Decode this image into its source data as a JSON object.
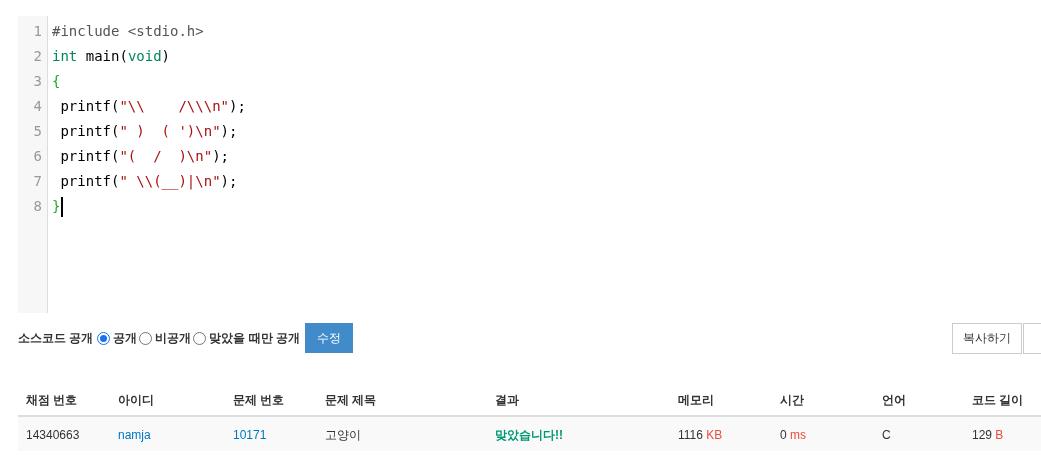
{
  "editor": {
    "lines": [
      {
        "number": "1",
        "tokens": [
          {
            "kind": "meta",
            "text": "#include <stdio.h>"
          }
        ]
      },
      {
        "number": "2",
        "tokens": [
          {
            "kind": "keyword",
            "text": "int"
          },
          {
            "kind": "plain",
            "text": " main("
          },
          {
            "kind": "keyword",
            "text": "void"
          },
          {
            "kind": "plain",
            "text": ")"
          }
        ]
      },
      {
        "number": "3",
        "tokens": [
          {
            "kind": "bracket",
            "text": "{"
          }
        ]
      },
      {
        "number": "4",
        "tokens": [
          {
            "kind": "plain",
            "text": " printf("
          },
          {
            "kind": "string",
            "text": "\"\\\\    /\\\\\\n\""
          },
          {
            "kind": "plain",
            "text": ");"
          }
        ]
      },
      {
        "number": "5",
        "tokens": [
          {
            "kind": "plain",
            "text": " printf("
          },
          {
            "kind": "string",
            "text": "\" )  ( ')\\n\""
          },
          {
            "kind": "plain",
            "text": ");"
          }
        ]
      },
      {
        "number": "6",
        "tokens": [
          {
            "kind": "plain",
            "text": " printf("
          },
          {
            "kind": "string",
            "text": "\"(  /  )\\n\""
          },
          {
            "kind": "plain",
            "text": ");"
          }
        ]
      },
      {
        "number": "7",
        "tokens": [
          {
            "kind": "plain",
            "text": " printf("
          },
          {
            "kind": "string",
            "text": "\" \\\\(__)|\\n\""
          },
          {
            "kind": "plain",
            "text": ");"
          }
        ]
      },
      {
        "number": "8",
        "cursor": true,
        "tokens": [
          {
            "kind": "bracket",
            "text": "}"
          }
        ]
      }
    ]
  },
  "source_visibility": {
    "label": "소스코드 공개",
    "options": [
      {
        "label": "공개",
        "selected": true
      },
      {
        "label": "비공개",
        "selected": false
      },
      {
        "label": "맞았을 때만 공개",
        "selected": false
      }
    ],
    "submit": "수정"
  },
  "actions": [
    {
      "label": "복사하기"
    }
  ],
  "table": {
    "columns": [
      "채점 번호",
      "아이디",
      "문제 번호",
      "문제 제목",
      "결과",
      "메모리",
      "시간",
      "언어",
      "코드 길이"
    ],
    "rows": [
      [
        {
          "kind": "plain",
          "text": "14340663"
        },
        {
          "kind": "link",
          "text": "namja"
        },
        {
          "kind": "link",
          "text": "10171"
        },
        {
          "kind": "plain",
          "text": "고양이"
        },
        {
          "kind": "result",
          "text": "맞았습니다!!"
        },
        {
          "kind": "unit",
          "text": "1116",
          "unit": "KB"
        },
        {
          "kind": "unit",
          "text": "0",
          "unit": "ms"
        },
        {
          "kind": "plain",
          "text": "C"
        },
        {
          "kind": "unit",
          "text": "129",
          "unit": "B"
        }
      ]
    ]
  }
}
